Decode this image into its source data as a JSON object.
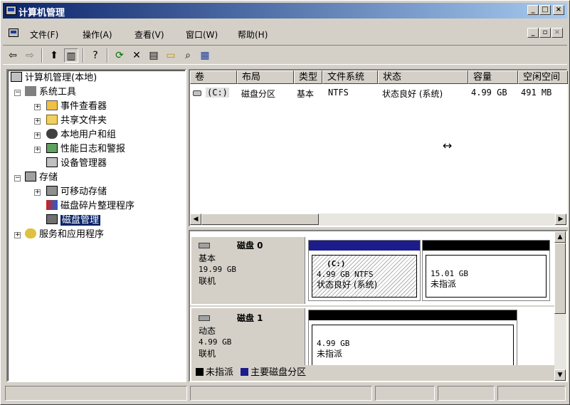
{
  "window": {
    "title": "计算机管理"
  },
  "menu": {
    "items": [
      "文件(F)",
      "操作(A)",
      "查看(V)",
      "窗口(W)",
      "帮助(H)"
    ]
  },
  "tree": {
    "root": "计算机管理(本地)",
    "system_tools": "系统工具",
    "event_viewer": "事件查看器",
    "shared_folders": "共享文件夹",
    "local_users": "本地用户和组",
    "perf_logs": "性能日志和警报",
    "device_manager": "设备管理器",
    "storage": "存储",
    "removable_storage": "可移动存储",
    "defrag": "磁盘碎片整理程序",
    "disk_mgmt": "磁盘管理",
    "services": "服务和应用程序"
  },
  "volume_table": {
    "columns": [
      "卷",
      "布局",
      "类型",
      "文件系统",
      "状态",
      "容量",
      "空闲空间"
    ],
    "rows": [
      {
        "volume": "(C:)",
        "layout": "磁盘分区",
        "type": "基本",
        "fs": "NTFS",
        "status": "状态良好 (系统)",
        "capacity": "4.99 GB",
        "free": "491 MB"
      }
    ]
  },
  "disks": [
    {
      "name": "磁盘 0",
      "kind": "基本",
      "size": "19.99 GB",
      "state": "联机",
      "partitions": [
        {
          "label": "(C:)",
          "line1": "4.99 GB NTFS",
          "line2": "状态良好 (系统)"
        },
        {
          "line1": "15.01 GB",
          "line2": "未指派"
        }
      ]
    },
    {
      "name": "磁盘 1",
      "kind": "动态",
      "size": "4.99 GB",
      "state": "联机",
      "partitions": [
        {
          "line1": "4.99 GB",
          "line2": "未指派"
        }
      ]
    }
  ],
  "legend": {
    "unallocated": "未指派",
    "primary": "主要磁盘分区"
  },
  "colors": {
    "titlebar": "#0a246a",
    "primary": "#1c1c8c",
    "unallocated": "#000000",
    "selection": "#0a246a"
  }
}
